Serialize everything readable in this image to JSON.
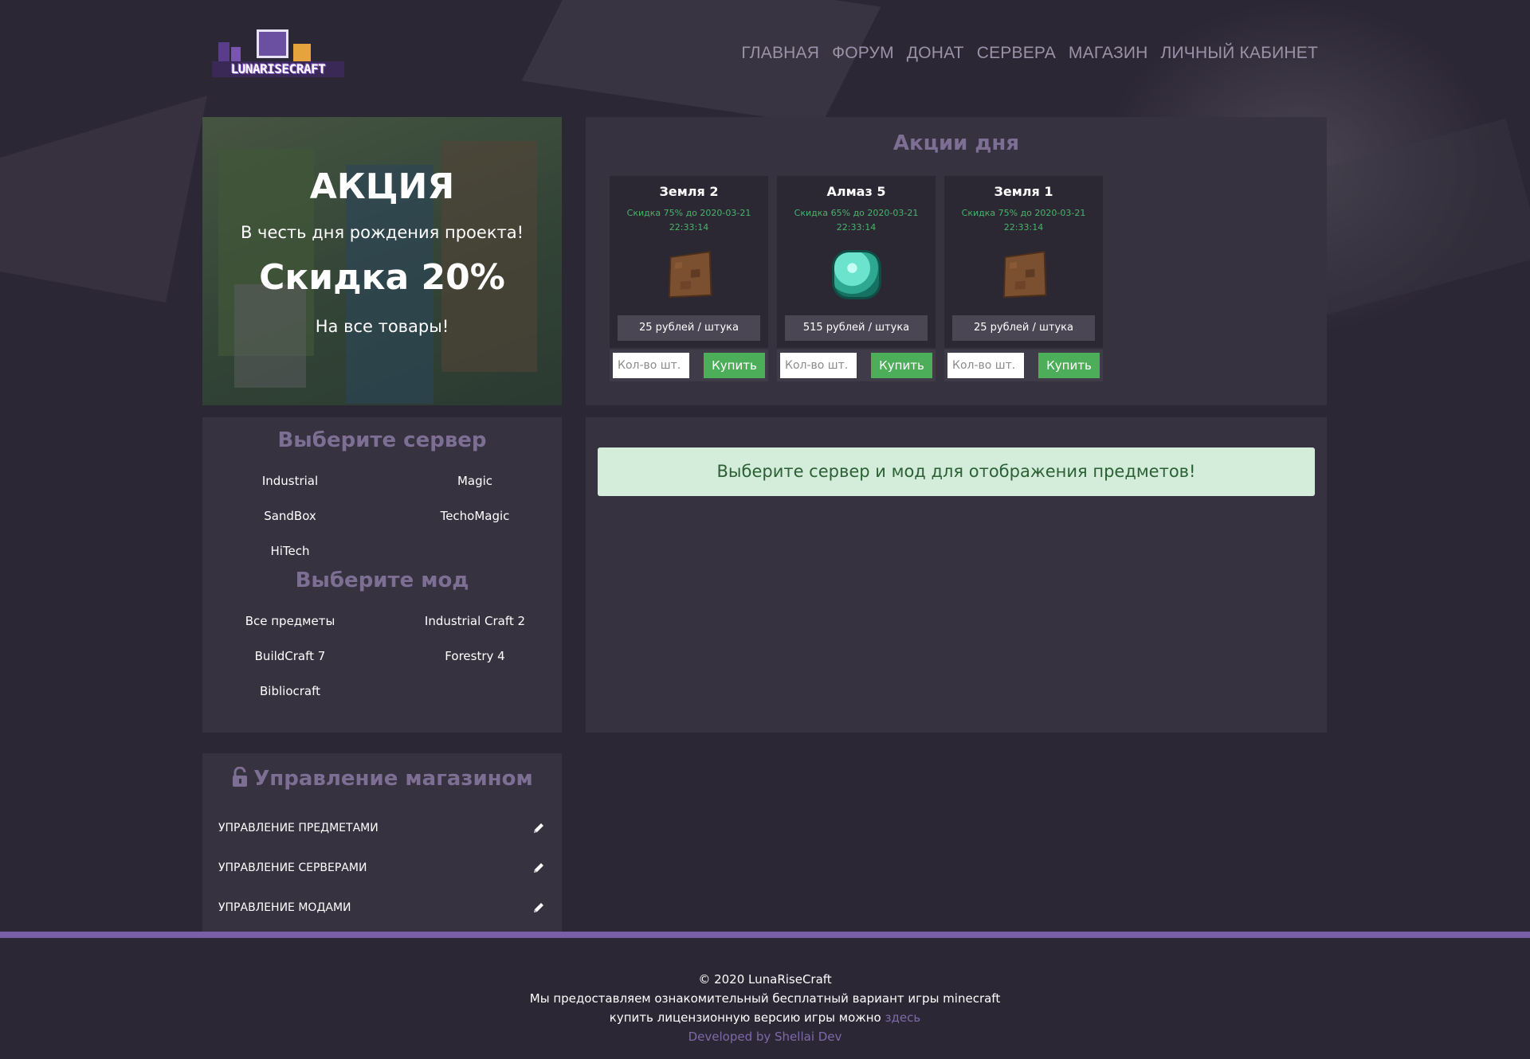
{
  "brand": {
    "logo_text": "LUNARISECRAFT"
  },
  "nav": {
    "items": [
      "ГЛАВНАЯ",
      "ФОРУМ",
      "ДОНАТ",
      "СЕРВЕРА",
      "МАГАЗИН",
      "ЛИЧНЫЙ КАБИНЕТ"
    ]
  },
  "promo": {
    "title": "АКЦИЯ",
    "subtitle": "В честь дня рождения проекта!",
    "discount": "Скидка 20%",
    "scope": "На все товары!"
  },
  "deals": {
    "title": "Акции дня",
    "cards": [
      {
        "name": "Земля 2",
        "info": "Скидка 75% до 2020-03-21 22:33:14",
        "icon": "dirt-block-icon",
        "price": "25 рублей / штука"
      },
      {
        "name": "Алмаз 5",
        "info": "Скидка 65% до 2020-03-21 22:33:14",
        "icon": "diamond-icon",
        "price": "515 рублей / штука"
      },
      {
        "name": "Земля 1",
        "info": "Скидка 75% до 2020-03-21 22:33:14",
        "icon": "dirt-block-icon",
        "price": "25 рублей / штука"
      }
    ],
    "qty_placeholder": "Кол-во шт.",
    "buy_label": "Купить"
  },
  "servers": {
    "title": "Выберите сервер",
    "items": [
      "Industrial",
      "Magic",
      "SandBox",
      "TechoMagic",
      "HiTech"
    ]
  },
  "mods": {
    "title": "Выберите мод",
    "items": [
      "Все предметы",
      "Industrial Craft 2",
      "BuildCraft 7",
      "Forestry 4",
      "Bibliocraft"
    ]
  },
  "items_area": {
    "alert": "Выберите сервер и мод для отображения предметов!"
  },
  "admin": {
    "title": "Управление магазином",
    "rows": [
      "УПРАВЛЕНИЕ ПРЕДМЕТАМИ",
      "УПРАВЛЕНИЕ СЕРВЕРАМИ",
      "УПРАВЛЕНИЕ МОДАМИ"
    ]
  },
  "footer": {
    "copyright": "© 2020 LunaRiseCraft",
    "line1": "Мы предоставляем ознакомительный бесплатный вариант игры minecraft",
    "line2_prefix": "купить лицензионную версию игры можно",
    "line2_link": "здесь",
    "dev": "Developed by Shellai Dev"
  },
  "colors": {
    "background": "#2c2735",
    "panel": "#363240",
    "heading": "#7d6f94",
    "accent_purple": "#7b5ea8",
    "buy_green": "#4dae5a",
    "discount_green": "#49b46a",
    "alert_bg": "#d4eddb"
  }
}
